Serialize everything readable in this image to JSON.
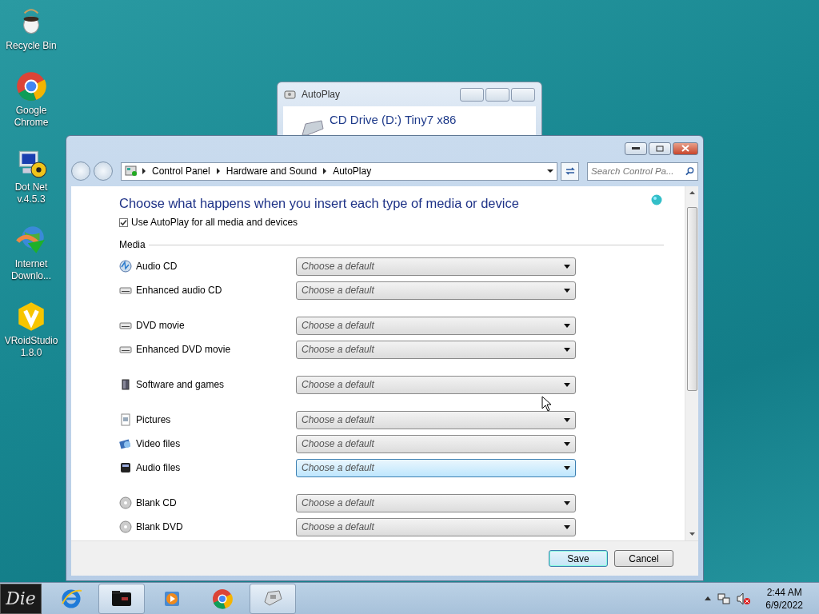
{
  "desktop_icons": [
    {
      "label": "Recycle Bin",
      "kind": "bin"
    },
    {
      "label": "Google Chrome",
      "kind": "chrome"
    },
    {
      "label": "Dot Net v.4.5.3",
      "kind": "dotnet"
    },
    {
      "label": "Internet Downlo...",
      "kind": "idm"
    },
    {
      "label": "VRoidStudio 1.8.0",
      "kind": "vroid"
    }
  ],
  "back_window": {
    "title": "AutoPlay",
    "heading": "CD Drive (D:) Tiny7 x86"
  },
  "window": {
    "breadcrumb": [
      "Control Panel",
      "Hardware and Sound",
      "AutoPlay"
    ],
    "search": {
      "placeholder": "Search Control Pa..."
    },
    "heading": "Choose what happens when you insert each type of media or device",
    "autoplay_all": {
      "label": "Use AutoPlay for all media and devices",
      "checked": true
    },
    "section": "Media",
    "groups": [
      {
        "items": [
          {
            "label": "Audio CD",
            "kind": "audio-cd",
            "value": "Choose a default",
            "hovered": false
          },
          {
            "label": "Enhanced audio CD",
            "kind": "drive",
            "value": "Choose a default",
            "hovered": false
          }
        ]
      },
      {
        "items": [
          {
            "label": "DVD movie",
            "kind": "drive",
            "value": "Choose a default",
            "hovered": false
          },
          {
            "label": "Enhanced DVD movie",
            "kind": "drive",
            "value": "Choose a default",
            "hovered": false
          }
        ]
      },
      {
        "items": [
          {
            "label": "Software and games",
            "kind": "software",
            "value": "Choose a default",
            "hovered": false
          }
        ]
      },
      {
        "items": [
          {
            "label": "Pictures",
            "kind": "pictures",
            "value": "Choose a default",
            "hovered": false
          },
          {
            "label": "Video files",
            "kind": "video",
            "value": "Choose a default",
            "hovered": false
          },
          {
            "label": "Audio files",
            "kind": "audio",
            "value": "Choose a default",
            "hovered": true
          }
        ]
      },
      {
        "items": [
          {
            "label": "Blank CD",
            "kind": "disc",
            "value": "Choose a default",
            "hovered": false
          },
          {
            "label": "Blank DVD",
            "kind": "disc",
            "value": "Choose a default",
            "hovered": false
          }
        ]
      }
    ],
    "buttons": [
      {
        "label": "Save",
        "kind": "default"
      },
      {
        "label": "Cancel",
        "kind": "normal"
      }
    ]
  },
  "taskbar": {
    "start_label": "Die",
    "items": [
      {
        "kind": "ie",
        "active": false
      },
      {
        "kind": "folder",
        "active": true
      },
      {
        "kind": "media",
        "active": false
      },
      {
        "kind": "chrome",
        "active": false
      },
      {
        "kind": "autoplay",
        "active": true
      }
    ],
    "clock": {
      "time": "2:44 AM",
      "date": "6/9/2022"
    }
  }
}
